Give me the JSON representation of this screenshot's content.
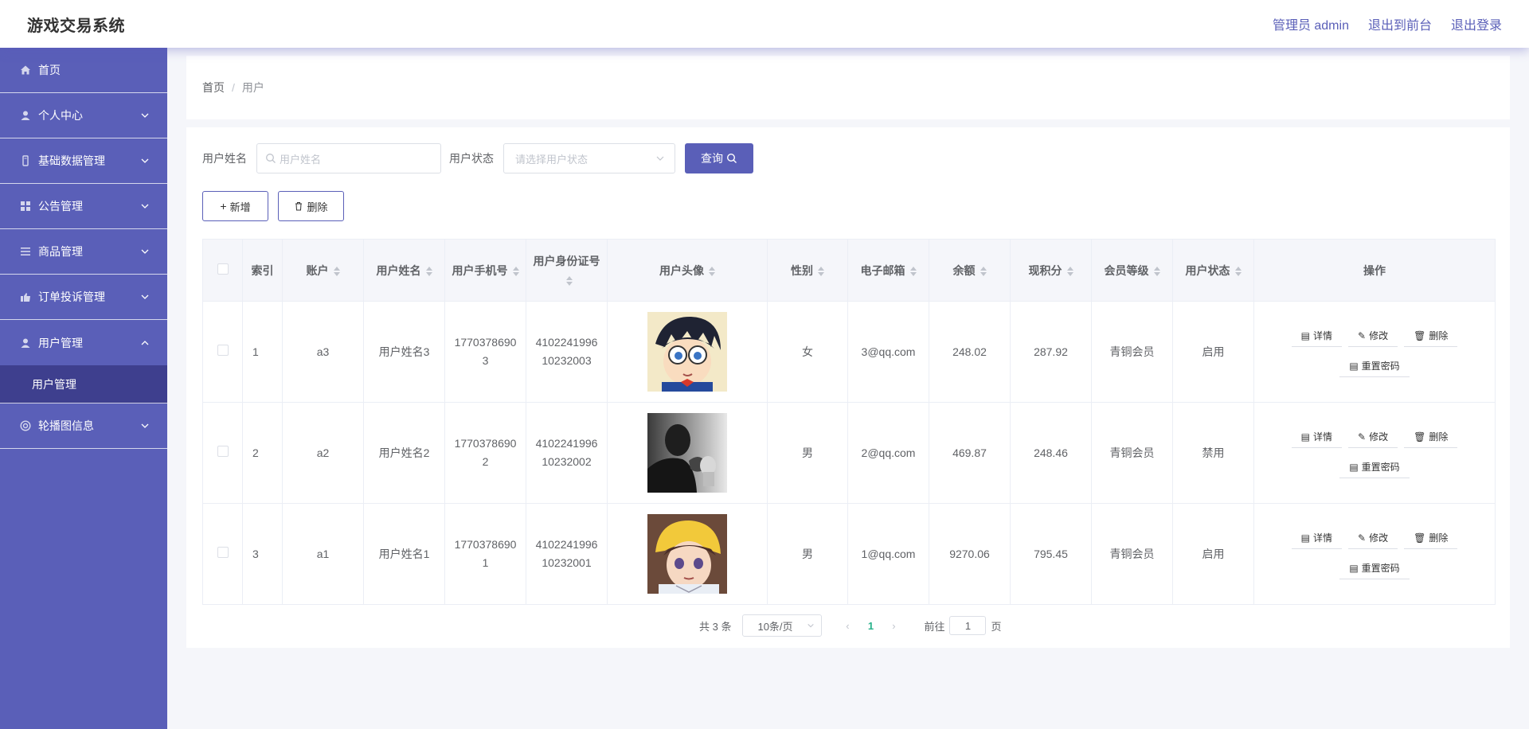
{
  "header": {
    "title": "游戏交易系统",
    "admin_label": "管理员 admin",
    "exit_front_label": "退出到前台",
    "logout_label": "退出登录"
  },
  "sidebar": {
    "items": [
      {
        "label": "首页",
        "icon": "home-icon"
      },
      {
        "label": "个人中心",
        "icon": "user-icon"
      },
      {
        "label": "基础数据管理",
        "icon": "data-icon"
      },
      {
        "label": "公告管理",
        "icon": "grid-icon"
      },
      {
        "label": "商品管理",
        "icon": "list-icon"
      },
      {
        "label": "订单投诉管理",
        "icon": "order-icon"
      },
      {
        "label": "用户管理",
        "icon": "user-icon"
      },
      {
        "label": "轮播图信息",
        "icon": "carousel-icon"
      }
    ],
    "sub_item_label": "用户管理"
  },
  "breadcrumb": {
    "home": "首页",
    "separator": "/",
    "current": "用户"
  },
  "search": {
    "name_label": "用户姓名",
    "name_placeholder": "用户姓名",
    "status_label": "用户状态",
    "status_placeholder": "请选择用户状态",
    "query_label": "查询"
  },
  "actions": {
    "add_label": "新增",
    "delete_label": "删除"
  },
  "table": {
    "headers": {
      "index": "索引",
      "account": "账户",
      "name": "用户姓名",
      "phone": "用户手机号",
      "idcard": "用户身份证号",
      "avatar": "用户头像",
      "gender": "性别",
      "email": "电子邮箱",
      "balance": "余额",
      "points": "现积分",
      "level": "会员等级",
      "status": "用户状态",
      "ops": "操作"
    },
    "rows": [
      {
        "index": "1",
        "account": "a3",
        "name": "用户姓名3",
        "phone": "17703786903",
        "idcard": "410224199610232003",
        "gender": "女",
        "email": "3@qq.com",
        "balance": "248.02",
        "points": "287.92",
        "level": "青铜会员",
        "status": "启用"
      },
      {
        "index": "2",
        "account": "a2",
        "name": "用户姓名2",
        "phone": "17703786902",
        "idcard": "410224199610232002",
        "gender": "男",
        "email": "2@qq.com",
        "balance": "469.87",
        "points": "248.46",
        "level": "青铜会员",
        "status": "禁用"
      },
      {
        "index": "3",
        "account": "a1",
        "name": "用户姓名1",
        "phone": "17703786901",
        "idcard": "410224199610232001",
        "gender": "男",
        "email": "1@qq.com",
        "balance": "9270.06",
        "points": "795.45",
        "level": "青铜会员",
        "status": "启用"
      }
    ],
    "op_labels": {
      "detail": "详情",
      "edit": "修改",
      "delete": "删除",
      "reset": "重置密码"
    }
  },
  "pagination": {
    "total_text": "共 3 条",
    "page_size": "10条/页",
    "current_page": "1",
    "goto_label": "前往",
    "goto_value": "1",
    "page_suffix": "页"
  }
}
